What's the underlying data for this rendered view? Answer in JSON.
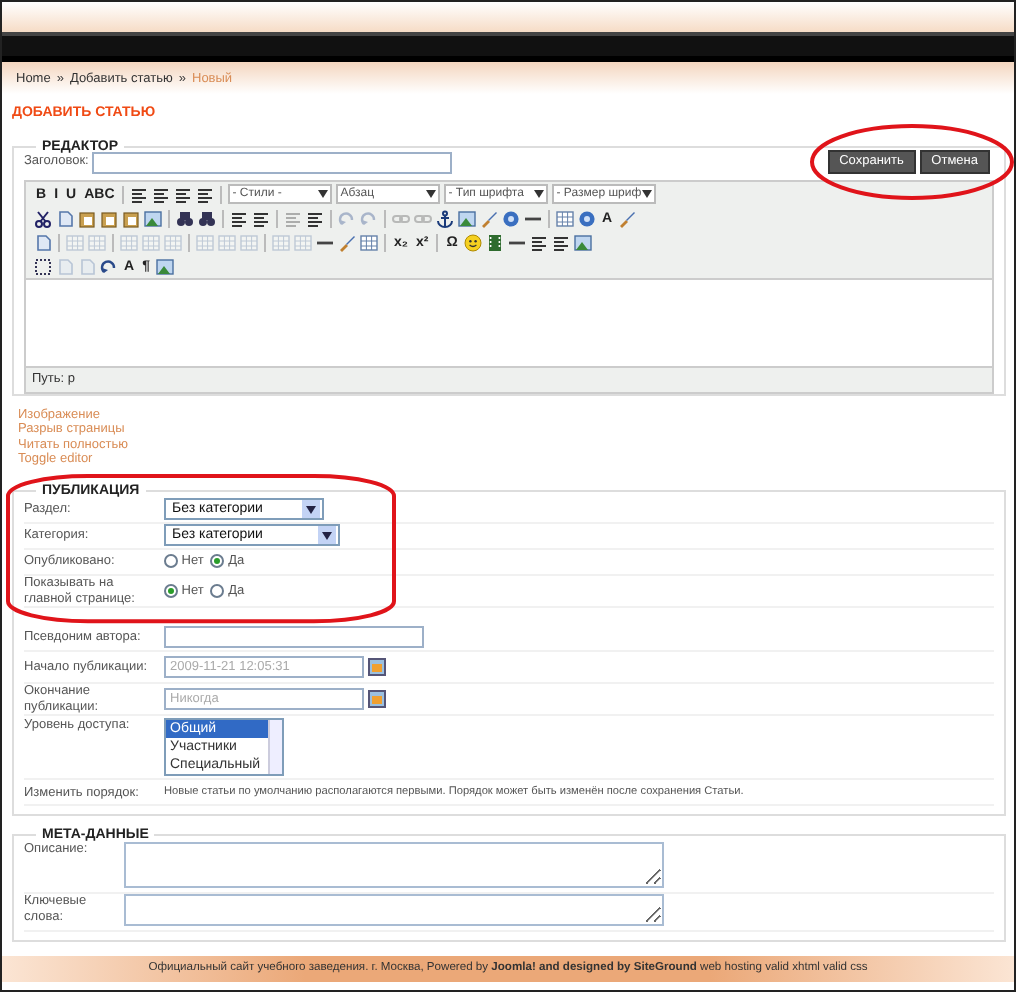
{
  "breadcrumb": [
    {
      "label": "Home",
      "current": false,
      "separator": "»"
    },
    {
      "label": "Добавить статью",
      "current": false,
      "separator": "»"
    },
    {
      "label": "Новый",
      "current": true
    }
  ],
  "page_title": "ДОБАВИТЬ СТАТЬЮ",
  "editor": {
    "legend": "РЕДАКТОР",
    "title_label": "Заголовок:",
    "buttons": [
      "Сохранить",
      "Отмена"
    ],
    "toolbar_rows": [
      [
        {
          "kind": "glyph",
          "text": "B",
          "disabled": false
        },
        {
          "kind": "glyph",
          "text": "I",
          "disabled": false
        },
        {
          "kind": "glyph",
          "text": "U",
          "disabled": false
        },
        {
          "kind": "glyph",
          "text": "ABC",
          "disabled": false
        },
        {
          "kind": "sep"
        },
        {
          "kind": "lines",
          "disabled": false
        },
        {
          "kind": "lines",
          "disabled": false
        },
        {
          "kind": "lines",
          "disabled": false
        },
        {
          "kind": "lines",
          "disabled": false
        },
        {
          "kind": "sep"
        },
        {
          "kind": "select",
          "text": "- Стили -"
        },
        {
          "kind": "select",
          "text": "Абзац"
        },
        {
          "kind": "select",
          "text": "- Тип шрифта"
        },
        {
          "kind": "select",
          "text": "- Размер шриф"
        }
      ],
      [
        {
          "kind": "scissors",
          "disabled": false
        },
        {
          "kind": "page",
          "disabled": false
        },
        {
          "kind": "clipboard",
          "disabled": false
        },
        {
          "kind": "clipboard",
          "disabled": false
        },
        {
          "kind": "clipboard",
          "disabled": false
        },
        {
          "kind": "picture",
          "disabled": false
        },
        {
          "kind": "sep"
        },
        {
          "kind": "binoculars",
          "disabled": false
        },
        {
          "kind": "binoculars",
          "disabled": false
        },
        {
          "kind": "sep"
        },
        {
          "kind": "lines",
          "disabled": false
        },
        {
          "kind": "lines",
          "disabled": false
        },
        {
          "kind": "sep"
        },
        {
          "kind": "lines",
          "disabled": true
        },
        {
          "kind": "lines",
          "disabled": false
        },
        {
          "kind": "sep"
        },
        {
          "kind": "arrow",
          "disabled": true
        },
        {
          "kind": "arrow",
          "disabled": true
        },
        {
          "kind": "sep"
        },
        {
          "kind": "chain",
          "disabled": true
        },
        {
          "kind": "chain",
          "disabled": true
        },
        {
          "kind": "anchor",
          "disabled": false
        },
        {
          "kind": "picture",
          "disabled": false
        },
        {
          "kind": "brush",
          "disabled": false
        },
        {
          "kind": "disc",
          "disabled": false
        },
        {
          "kind": "rule",
          "disabled": false
        },
        {
          "kind": "sep"
        },
        {
          "kind": "table",
          "disabled": false
        },
        {
          "kind": "disc",
          "disabled": false
        },
        {
          "kind": "glyph",
          "text": "A",
          "disabled": false
        },
        {
          "kind": "brush",
          "disabled": false
        }
      ],
      [
        {
          "kind": "page",
          "disabled": false
        },
        {
          "kind": "sep"
        },
        {
          "kind": "table",
          "disabled": true
        },
        {
          "kind": "table",
          "disabled": true
        },
        {
          "kind": "sep"
        },
        {
          "kind": "table",
          "disabled": true
        },
        {
          "kind": "table",
          "disabled": true
        },
        {
          "kind": "table",
          "disabled": true
        },
        {
          "kind": "sep"
        },
        {
          "kind": "table",
          "disabled": true
        },
        {
          "kind": "table",
          "disabled": true
        },
        {
          "kind": "table",
          "disabled": true
        },
        {
          "kind": "sep"
        },
        {
          "kind": "table",
          "disabled": true
        },
        {
          "kind": "table",
          "disabled": true
        },
        {
          "kind": "rule",
          "disabled": false
        },
        {
          "kind": "brush",
          "disabled": false
        },
        {
          "kind": "table",
          "disabled": false
        },
        {
          "kind": "sep"
        },
        {
          "kind": "glyph",
          "text": "x₂",
          "disabled": false
        },
        {
          "kind": "glyph",
          "text": "x²",
          "disabled": false
        },
        {
          "kind": "sep"
        },
        {
          "kind": "glyph",
          "text": "Ω",
          "disabled": false
        },
        {
          "kind": "smiley",
          "disabled": false
        },
        {
          "kind": "film",
          "disabled": false
        },
        {
          "kind": "rule",
          "disabled": false
        },
        {
          "kind": "lines",
          "disabled": false
        },
        {
          "kind": "lines",
          "disabled": false
        },
        {
          "kind": "picture",
          "disabled": false
        }
      ],
      [
        {
          "kind": "dashed",
          "disabled": false
        },
        {
          "kind": "page",
          "disabled": true
        },
        {
          "kind": "page",
          "disabled": true
        },
        {
          "kind": "arrow",
          "disabled": false
        },
        {
          "kind": "glyph",
          "text": "A",
          "disabled": false
        },
        {
          "kind": "glyph",
          "text": "¶",
          "disabled": false
        },
        {
          "kind": "picture",
          "disabled": false
        }
      ]
    ],
    "path": "Путь: p",
    "links": [
      "Изображение",
      "Разрыв страницы",
      "Читать полностью",
      "Toggle editor"
    ]
  },
  "publication": {
    "legend": "ПУБЛИКАЦИЯ",
    "fields": [
      {
        "kind": "select",
        "label": "Раздел:",
        "value": "Без категории"
      },
      {
        "kind": "select",
        "label": "Категория:",
        "value": "Без категории"
      },
      {
        "kind": "radio",
        "label": "Опубликовано:",
        "options": [
          {
            "label": "Нет",
            "selected": false
          },
          {
            "label": "Да",
            "selected": true
          }
        ]
      },
      {
        "kind": "radio",
        "label": "Показывать на главной странице:",
        "options": [
          {
            "label": "Нет",
            "selected": true
          },
          {
            "label": "Да",
            "selected": false
          }
        ]
      },
      {
        "kind": "text",
        "label": "Псевдоним автора:"
      },
      {
        "kind": "date",
        "label": "Начало публикации:",
        "value": "2009-11-21 12:05:31"
      },
      {
        "kind": "date",
        "label": "Окончание публикации:",
        "value": "Никогда"
      },
      {
        "kind": "listbox",
        "label": "Уровень доступа:",
        "options": [
          {
            "label": "Общий",
            "selected": true
          },
          {
            "label": "Участники",
            "selected": false
          },
          {
            "label": "Специальный",
            "selected": false
          }
        ]
      },
      {
        "kind": "note",
        "label": "Изменить порядок:",
        "text": "Новые статьи по умолчанию располагаются первыми. Порядок может быть изменён после сохранения Статьи."
      }
    ]
  },
  "metadata": {
    "legend": "МЕТА-ДАННЫЕ",
    "fields": [
      {
        "label": "Описание:",
        "kind": "tall"
      },
      {
        "label": "Ключевые слова:",
        "kind": "short"
      }
    ]
  },
  "footer": "Официальный сайт учебного заведения. г. Москва, Powered by **Joomla! and designed by SiteGround** web hosting valid xhtml valid css"
}
